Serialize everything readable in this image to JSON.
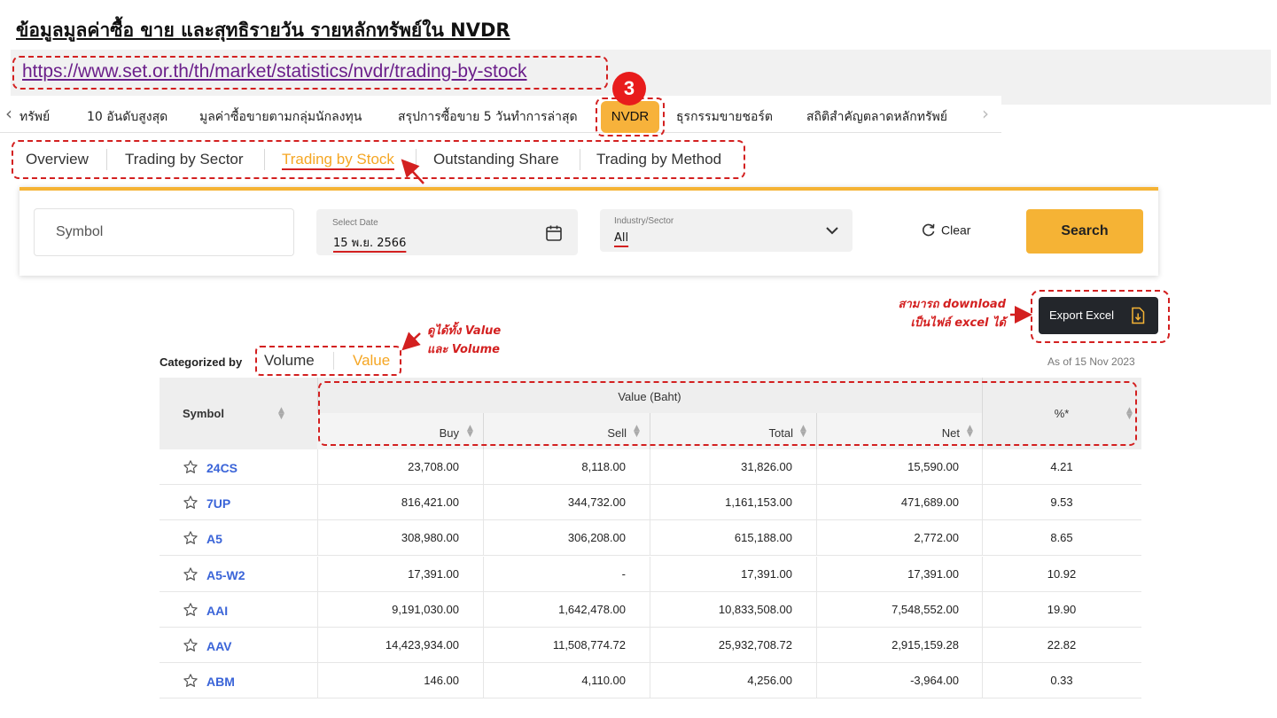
{
  "page": {
    "title": "ข้อมูลมูลค่าซื้อ ขาย และสุทธิรายวัน รายหลักทรัพย์ใน NVDR",
    "url": "https://www.set.or.th/th/market/statistics/nvdr/trading-by-stock",
    "step_badge": "3"
  },
  "menu": {
    "items": [
      "ทรัพย์",
      "10 อันดับสูงสุด",
      "มูลค่าซื้อขายตามกลุ่มนักลงทุน",
      "สรุปการซื้อขาย 5 วันทำการล่าสุด",
      "NVDR",
      "ธุรกรรมขายชอร์ต",
      "สถิติสำคัญตลาดหลักทรัพย์"
    ],
    "active": "NVDR"
  },
  "subtabs": {
    "items": [
      "Overview",
      "Trading by Sector",
      "Trading by Stock",
      "Outstanding Share",
      "Trading by Method"
    ],
    "active": "Trading by Stock"
  },
  "filters": {
    "symbol_placeholder": "Symbol",
    "date_label": "Select Date",
    "date_value": "15 พ.ย. 2566",
    "industry_label": "Industry/Sector",
    "industry_value": "All",
    "clear_label": "Clear",
    "search_label": "Search"
  },
  "notes": {
    "export_line1": "สามารถ download",
    "export_line2": "เป็นไฟล์ excel ได้",
    "value_line1": "ดูได้ทั้ง Value",
    "value_line2": "และ Volume"
  },
  "export": {
    "label": "Export Excel"
  },
  "categorized": {
    "label": "Categorized by",
    "options": [
      "Volume",
      "Value"
    ],
    "active": "Value"
  },
  "as_of": "As of 15 Nov 2023",
  "table": {
    "headers": {
      "symbol": "Symbol",
      "group": "Value (Baht)",
      "buy": "Buy",
      "sell": "Sell",
      "total": "Total",
      "net": "Net",
      "pct": "%*"
    },
    "rows": [
      {
        "symbol": "24CS",
        "buy": "23,708.00",
        "sell": "8,118.00",
        "total": "31,826.00",
        "net": "15,590.00",
        "pct": "4.21"
      },
      {
        "symbol": "7UP",
        "buy": "816,421.00",
        "sell": "344,732.00",
        "total": "1,161,153.00",
        "net": "471,689.00",
        "pct": "9.53"
      },
      {
        "symbol": "A5",
        "buy": "308,980.00",
        "sell": "306,208.00",
        "total": "615,188.00",
        "net": "2,772.00",
        "pct": "8.65"
      },
      {
        "symbol": "A5-W2",
        "buy": "17,391.00",
        "sell": "-",
        "total": "17,391.00",
        "net": "17,391.00",
        "pct": "10.92"
      },
      {
        "symbol": "AAI",
        "buy": "9,191,030.00",
        "sell": "1,642,478.00",
        "total": "10,833,508.00",
        "net": "7,548,552.00",
        "pct": "19.90"
      },
      {
        "symbol": "AAV",
        "buy": "14,423,934.00",
        "sell": "11,508,774.72",
        "total": "25,932,708.72",
        "net": "2,915,159.28",
        "pct": "22.82"
      },
      {
        "symbol": "ABM",
        "buy": "146.00",
        "sell": "4,110.00",
        "total": "4,256.00",
        "net": "-3,964.00",
        "pct": "0.33"
      }
    ]
  },
  "colors": {
    "accent": "#f5b335",
    "active_text": "#f5a623",
    "annotation": "#d32020",
    "link": "#3a64d8",
    "dark_button": "#23262b"
  },
  "icons": [
    "chevron-left-icon",
    "chevron-right-icon",
    "calendar-icon",
    "chevron-down-icon",
    "refresh-icon",
    "excel-file-icon",
    "star-icon",
    "sort-icon"
  ]
}
